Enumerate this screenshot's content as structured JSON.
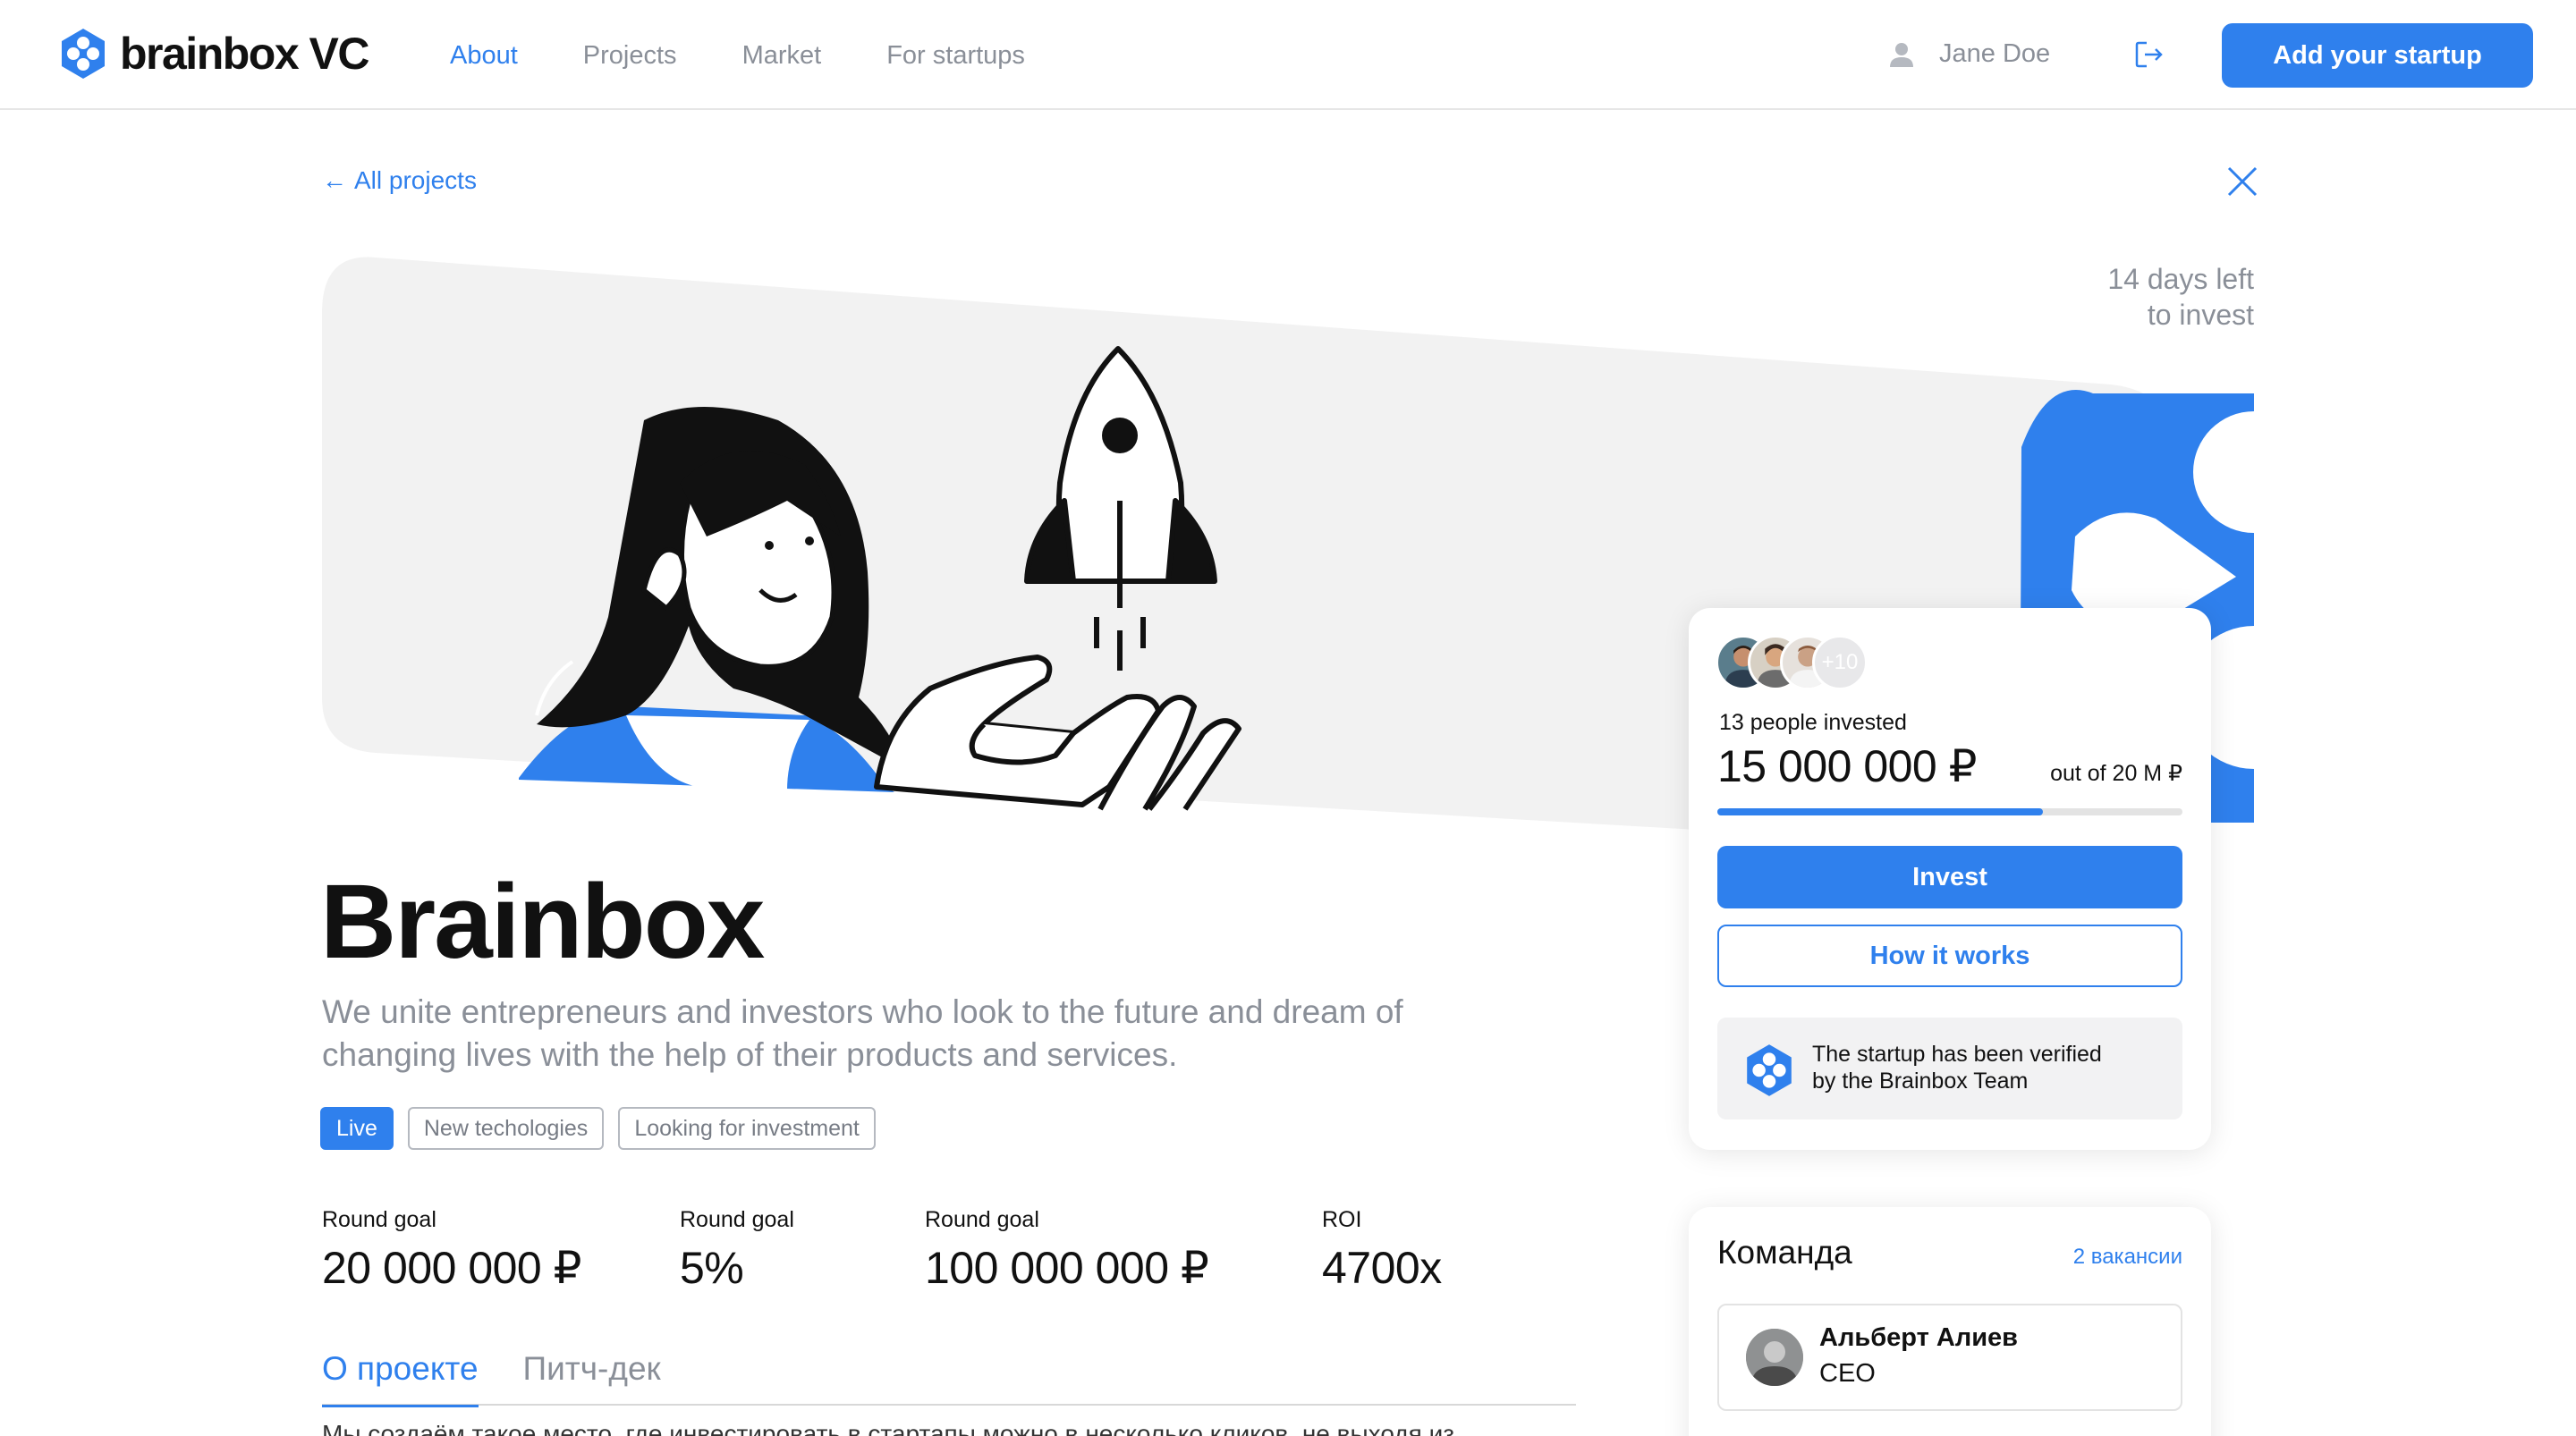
{
  "header": {
    "brand": "brainbox VC",
    "nav": [
      {
        "label": "About",
        "active": true
      },
      {
        "label": "Projects",
        "active": false
      },
      {
        "label": "Market",
        "active": false
      },
      {
        "label": "For startups",
        "active": false
      }
    ],
    "user_name": "Jane Doe",
    "add_startup_label": "Add your startup",
    "icons": [
      "user-icon",
      "logout-icon"
    ]
  },
  "back_link": "All projects",
  "days_left": {
    "line1": "14 days left",
    "line2": "to invest"
  },
  "project": {
    "title": "Brainbox",
    "subtitle": "We unite entrepreneurs and investors who look to the future and dream of changing lives with the help of their products and services.",
    "tags": [
      "Live",
      "New techologies",
      "Looking for investment"
    ]
  },
  "stats": [
    {
      "label": "Round goal",
      "value": "20 000 000 ₽"
    },
    {
      "label": "Round goal",
      "value": "5%"
    },
    {
      "label": "Round goal",
      "value": "100 000 000 ₽"
    },
    {
      "label": "ROI",
      "value": "4700x"
    }
  ],
  "tabs": [
    {
      "label": "О проекте",
      "active": true
    },
    {
      "label": "Питч-дек",
      "active": false
    }
  ],
  "body_text": "Мы создаём такое место, где инвестировать в стартапы можно в несколько кликов, не выходя из",
  "invest_card": {
    "more_count": "+10",
    "invested_people": "13 people invested",
    "amount": "15 000 000 ₽",
    "out_of": "out of 20 M ₽",
    "progress": 0.7,
    "invest_label": "Invest",
    "how_label": "How it works",
    "verified_line1": "The startup has been verified",
    "verified_line2": "by the Brainbox Team"
  },
  "team": {
    "title": "Команда",
    "vacancies": "2 вакансии",
    "members": [
      {
        "name": "Альберт Алиев",
        "role": "CEO"
      }
    ]
  },
  "colors": {
    "accent": "#2f80ed",
    "muted": "#8a8f98",
    "panel": "#f2f2f2"
  }
}
